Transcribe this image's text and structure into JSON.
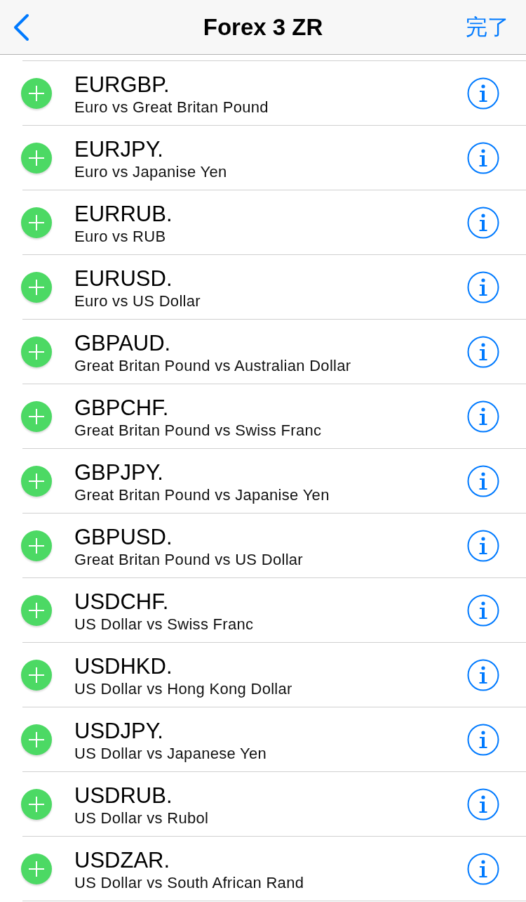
{
  "nav": {
    "title": "Forex 3 ZR",
    "done": "完了"
  },
  "items": [
    {
      "symbol": "EURGBP.",
      "description": "Euro vs Great Britan Pound"
    },
    {
      "symbol": "EURJPY.",
      "description": "Euro vs Japanise Yen"
    },
    {
      "symbol": "EURRUB.",
      "description": "Euro vs RUB"
    },
    {
      "symbol": "EURUSD.",
      "description": "Euro vs US Dollar"
    },
    {
      "symbol": "GBPAUD.",
      "description": "Great Britan Pound vs Australian Dollar"
    },
    {
      "symbol": "GBPCHF.",
      "description": "Great Britan Pound vs Swiss Franc"
    },
    {
      "symbol": "GBPJPY.",
      "description": "Great Britan Pound vs Japanise Yen"
    },
    {
      "symbol": "GBPUSD.",
      "description": "Great Britan Pound vs US Dollar"
    },
    {
      "symbol": "USDCHF.",
      "description": "US Dollar vs Swiss Franc"
    },
    {
      "symbol": "USDHKD.",
      "description": "US Dollar vs Hong Kong Dollar"
    },
    {
      "symbol": "USDJPY.",
      "description": "US Dollar vs Japanese Yen"
    },
    {
      "symbol": "USDRUB.",
      "description": "US Dollar vs Rubol"
    },
    {
      "symbol": "USDZAR.",
      "description": "US Dollar vs South African Rand"
    }
  ]
}
